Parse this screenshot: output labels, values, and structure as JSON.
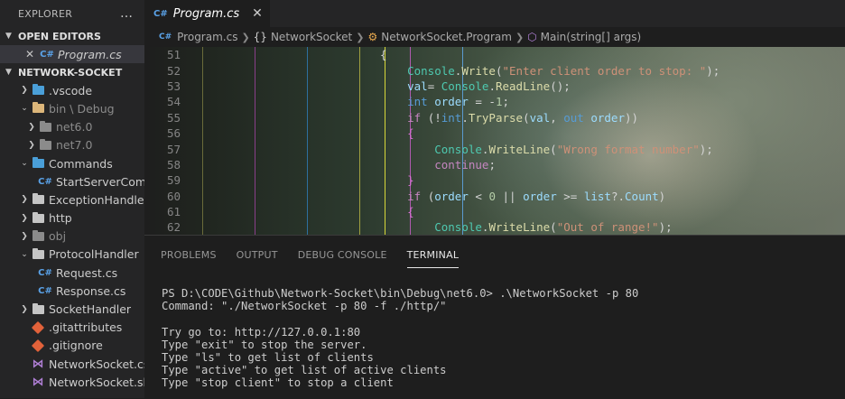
{
  "sidebar": {
    "title": "EXPLORER",
    "more_icon": "…",
    "open_editors_label": "OPEN EDITORS",
    "open_editor_file": "Program.cs",
    "project_label": "NETWORK-SOCKET",
    "items": [
      {
        "label": ".vscode"
      },
      {
        "label": "bin \\ Debug"
      },
      {
        "label": "net6.0"
      },
      {
        "label": "net7.0"
      },
      {
        "label": "Commands"
      },
      {
        "label": "StartServerCom..."
      },
      {
        "label": "ExceptionHandler"
      },
      {
        "label": "http"
      },
      {
        "label": "obj"
      },
      {
        "label": "ProtocolHandler"
      },
      {
        "label": "Request.cs"
      },
      {
        "label": "Response.cs"
      },
      {
        "label": "SocketHandler"
      },
      {
        "label": ".gitattributes"
      },
      {
        "label": ".gitignore"
      },
      {
        "label": "NetworkSocket.cs..."
      },
      {
        "label": "NetworkSocket.sln"
      }
    ]
  },
  "editor": {
    "tab_label": "Program.cs",
    "cs_badge": "C#",
    "breadcrumb": {
      "file": "Program.cs",
      "ns": "NetworkSocket",
      "cls": "NetworkSocket.Program",
      "method": "Main(string[] args)"
    },
    "line_numbers": [
      "51",
      "52",
      "53",
      "54",
      "55",
      "56",
      "57",
      "58",
      "59",
      "60",
      "61",
      "62"
    ]
  },
  "panel": {
    "tabs": [
      "PROBLEMS",
      "OUTPUT",
      "DEBUG CONSOLE",
      "TERMINAL"
    ],
    "active_tab": "TERMINAL",
    "terminal_lines": [
      "PS D:\\CODE\\Github\\Network-Socket\\bin\\Debug\\net6.0> .\\NetworkSocket -p 80",
      "Command: \"./NetworkSocket -p 80 -f ./http/\"",
      "",
      "Try go to: http://127.0.0.1:80",
      "Type \"exit\" to stop the server.",
      "Type \"ls\" to get list of clients",
      "Type \"active\" to get list of active clients",
      "Type \"stop client\" to stop a client"
    ]
  },
  "colors": {
    "accent_blue": "#5aa2e8",
    "git_orange": "#e2623a",
    "vs_purple": "#b180d7"
  }
}
